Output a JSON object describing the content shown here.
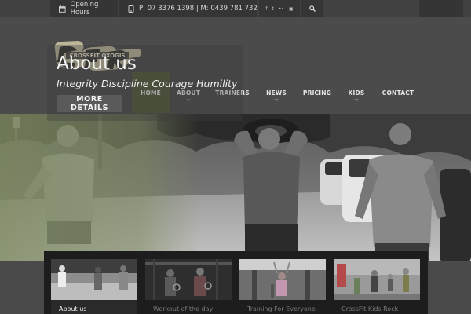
{
  "topbar": {
    "opening_hours": "Opening Hours",
    "phone": "P: 07 3376 1398 | M: 0439 781 732",
    "social_icons": [
      "f",
      "t",
      "••",
      "▣"
    ]
  },
  "logo": {
    "text": "CROSSFIT OXOGIS"
  },
  "nav": {
    "items": [
      {
        "label": "HOME",
        "active": true
      },
      {
        "label": "ABOUT",
        "active": false
      },
      {
        "label": "TRAINERS",
        "active": false
      },
      {
        "label": "NEWS",
        "active": false
      },
      {
        "label": "PRICING",
        "active": false
      },
      {
        "label": "KIDS",
        "active": false
      },
      {
        "label": "CONTACT",
        "active": false
      }
    ]
  },
  "hero": {
    "title": "About us",
    "subtitle": "Integrity Discipline Courage Humility",
    "button": "MORE DETAILS"
  },
  "thumbnails": [
    {
      "label": "About us",
      "active": true
    },
    {
      "label": "Workout of the day",
      "active": false
    },
    {
      "label": "Training For Everyone",
      "active": false
    },
    {
      "label": "CrossFit Kids Rock",
      "active": false
    }
  ],
  "colors": {
    "nav_active": "#51593b",
    "hero_tint": "#7d8a5f",
    "background": "#4a4a4a"
  }
}
